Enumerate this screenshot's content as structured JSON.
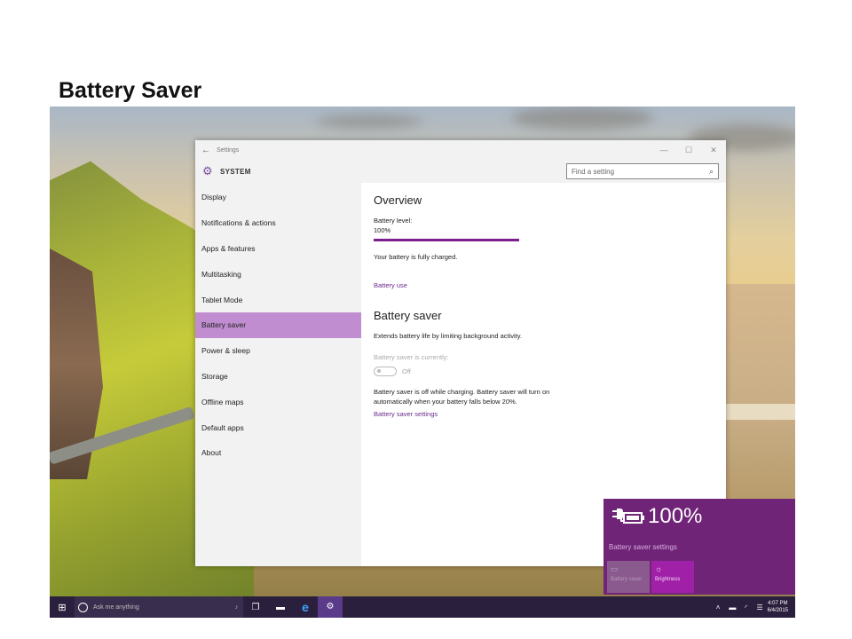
{
  "slide": {
    "title": "Battery Saver"
  },
  "window": {
    "title": "Settings",
    "back_icon": "back-arrow-icon",
    "controls": [
      "—",
      "☐",
      "✕"
    ]
  },
  "header": {
    "section": "SYSTEM",
    "search_placeholder": "Find a setting"
  },
  "nav": {
    "items": [
      {
        "label": "Display"
      },
      {
        "label": "Notifications & actions"
      },
      {
        "label": "Apps & features"
      },
      {
        "label": "Multitasking"
      },
      {
        "label": "Tablet Mode"
      },
      {
        "label": "Battery saver",
        "active": true
      },
      {
        "label": "Power & sleep"
      },
      {
        "label": "Storage"
      },
      {
        "label": "Offline maps"
      },
      {
        "label": "Default apps"
      },
      {
        "label": "About"
      }
    ]
  },
  "overview": {
    "heading": "Overview",
    "level_label": "Battery level:",
    "level_value": "100%",
    "level_fraction": 1.0,
    "status": "Your battery is fully charged.",
    "use_link": "Battery use"
  },
  "saver": {
    "heading": "Battery saver",
    "description": "Extends battery life by limiting background activity.",
    "currently_label": "Battery saver is currently:",
    "toggle_state": "Off",
    "note_line1": "Battery saver is off while charging. Battery saver will turn on",
    "note_line2": "automatically when your battery falls below 20%.",
    "settings_link": "Battery saver settings"
  },
  "flyout": {
    "percent": "100%",
    "settings_link": "Battery saver settings",
    "tile_battery": "Battery saver",
    "tile_brightness": "Brightness"
  },
  "taskbar": {
    "search_placeholder": "Ask me anything",
    "time": "4:07 PM",
    "date": "6/4/2015"
  },
  "colors": {
    "accent": "#7b1f8e",
    "nav_active": "#c08ed0",
    "flyout": "#6f2477"
  }
}
